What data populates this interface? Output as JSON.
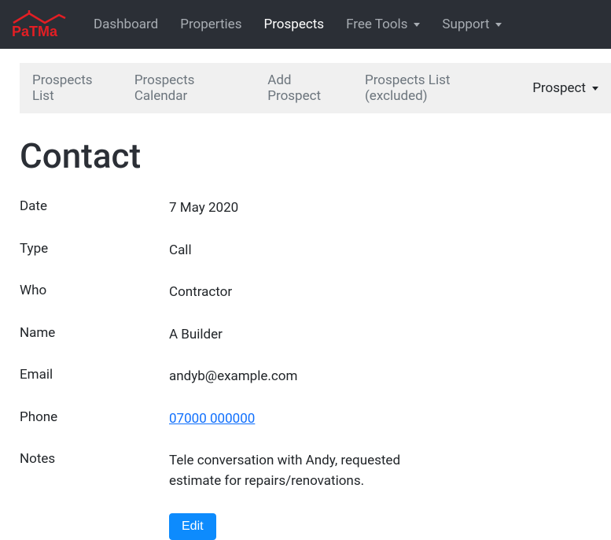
{
  "navbar": {
    "items": [
      {
        "label": "Dashboard"
      },
      {
        "label": "Properties"
      },
      {
        "label": "Prospects"
      },
      {
        "label": "Free Tools"
      },
      {
        "label": "Support"
      }
    ]
  },
  "subnav": {
    "items": [
      {
        "label": "Prospects List"
      },
      {
        "label": "Prospects Calendar"
      },
      {
        "label": "Add Prospect"
      },
      {
        "label": "Prospects List (excluded)"
      },
      {
        "label": "Prospect"
      }
    ]
  },
  "page": {
    "title": "Contact"
  },
  "fields": {
    "date": {
      "label": "Date",
      "value": "7 May 2020"
    },
    "type": {
      "label": "Type",
      "value": "Call"
    },
    "who": {
      "label": "Who",
      "value": "Contractor"
    },
    "name": {
      "label": "Name",
      "value": "A Builder"
    },
    "email": {
      "label": "Email",
      "value": "andyb@example.com"
    },
    "phone": {
      "label": "Phone",
      "value": "07000 000000"
    },
    "notes": {
      "label": "Notes",
      "value": "Tele conversation with Andy, requested estimate for repairs/renovations."
    }
  },
  "actions": {
    "edit_label": "Edit"
  }
}
